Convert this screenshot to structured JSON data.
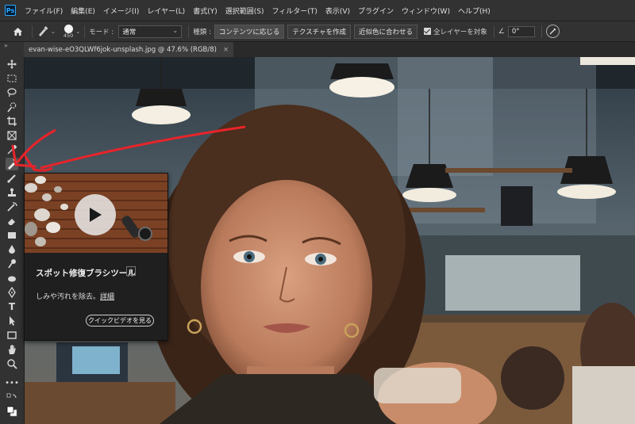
{
  "app": {
    "logo_text": "Ps"
  },
  "menu": [
    "ファイル(F)",
    "編集(E)",
    "イメージ(I)",
    "レイヤー(L)",
    "書式(Y)",
    "選択範囲(S)",
    "フィルター(T)",
    "表示(V)",
    "プラグイン",
    "ウィンドウ(W)",
    "ヘルプ(H)"
  ],
  "options": {
    "brush_size": "450",
    "mode_label": "モード :",
    "mode_value": "通常",
    "type_label": "種類 :",
    "type_buttons": [
      "コンテンツに応じる",
      "テクスチャを作成",
      "近似色に合わせる"
    ],
    "all_layers_label": "全レイヤーを対象",
    "angle_value": "0°"
  },
  "document": {
    "tab_title": "evan-wise-eO3QLWf6jok-unsplash.jpg @ 47.6% (RGB/8)",
    "close_symbol": "×"
  },
  "tooltip": {
    "title": "スポット修復ブラシツール",
    "shortcut": "J",
    "description": "しみや汚れを除去。",
    "detail_link": "詳細",
    "video_button": "クイックビデオを見る"
  },
  "toolbar": {
    "collapse_symbol": "»"
  },
  "colors": {
    "annotation_arrow": "#e8242a",
    "accent": "#31a8ff"
  }
}
